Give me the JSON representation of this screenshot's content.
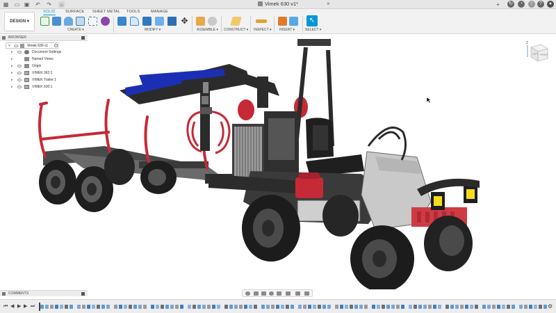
{
  "titlebar": {
    "document_title": "Vimek 630 v1*",
    "icons": [
      "grid-icon",
      "file-icon",
      "save-icon",
      "undo-icon",
      "redo-icon",
      "home-icon",
      "close-icon",
      "add-tab-icon",
      "refresh-icon",
      "clock-icon",
      "notifications-icon",
      "help-icon",
      "user-avatar"
    ]
  },
  "ribbon": {
    "workspace_label": "DESIGN ▾",
    "tabs": [
      "SOLID",
      "SURFACE",
      "SHEET METAL",
      "TOOLS",
      "MANAGE"
    ],
    "active_tab": "SOLID",
    "groups": [
      {
        "label": "CREATE ▾"
      },
      {
        "label": "MODIFY ▾"
      },
      {
        "label": "ASSEMBLE ▾"
      },
      {
        "label": "CONSTRUCT ▾"
      },
      {
        "label": "INSPECT ▾"
      },
      {
        "label": "INSERT ▾"
      },
      {
        "label": "SELECT ▾"
      }
    ],
    "accent_color": "#0696d7"
  },
  "browser": {
    "header": "BROWSER",
    "root": "Vimek 630 v1",
    "items": [
      {
        "label": "Document Settings",
        "icon": "gear-icon"
      },
      {
        "label": "Named Views",
        "icon": "folder-icon"
      },
      {
        "label": "Origin",
        "icon": "folder-icon"
      },
      {
        "label": "VIMEK 362:1",
        "icon": "component-icon"
      },
      {
        "label": "VIMEK Trailer:1",
        "icon": "component-icon"
      },
      {
        "label": "VIMEK 630:1",
        "icon": "component-icon"
      }
    ]
  },
  "viewcube": {
    "faces": [
      "LEFT",
      "FRONT"
    ],
    "axis": "Z"
  },
  "comments": {
    "label": "COMMENTS"
  },
  "timeline": {
    "controls": [
      "first-icon",
      "previous-icon",
      "play-icon",
      "next-icon",
      "last-icon"
    ],
    "gear": "gear-icon"
  },
  "colors": {
    "frame": "#2b2b2b",
    "tire": "#1e1e1e",
    "accent_red": "#c62a36",
    "panel_grey": "#c9c9c9",
    "crane_blue": "#1b2fb5"
  }
}
